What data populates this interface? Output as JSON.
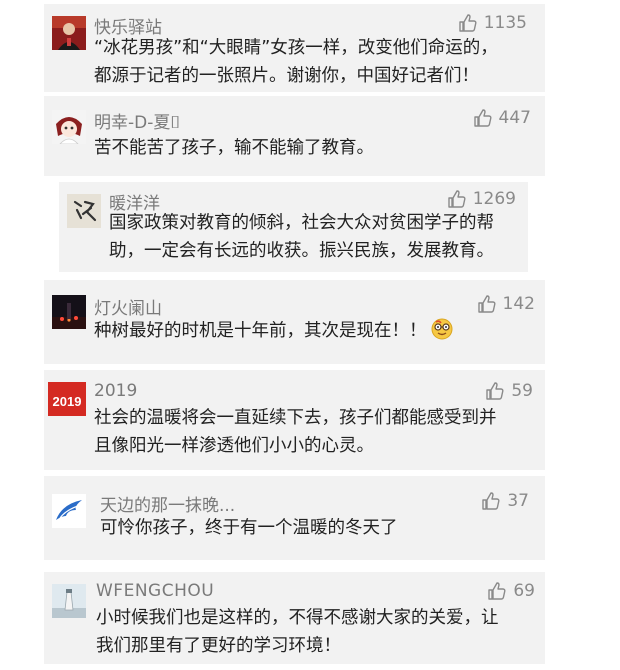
{
  "comments": [
    {
      "name": "快乐驿站",
      "likes": "1135",
      "lines": [
        "“冰花男孩”和“大眼睛”女孩一样，改变他们命运的，",
        "都源于记者的一张照片。谢谢你，中国好记者们！"
      ],
      "avatar_icon": "person-portrait-avatar"
    },
    {
      "name": "明幸-D-夏⌷",
      "likes": "447",
      "lines": [
        "苦不能苦了孩子，输不能输了教育。"
      ],
      "avatar_icon": "anime-girl-avatar"
    },
    {
      "name": "暖洋洋",
      "likes": "1269",
      "lines": [
        "国家政策对教育的倾斜，社会大众对贫困学子的帮",
        "助，一定会有长远的收获。振兴民族，发展教育。"
      ],
      "avatar_icon": "calligraphy-avatar"
    },
    {
      "name": "灯火阑山",
      "likes": "142",
      "lines": [
        "种树最好的时机是十年前，其次是现在！！"
      ],
      "emoji": "nerd-face-emoji",
      "avatar_icon": "night-scene-avatar"
    },
    {
      "name": "2019",
      "likes": "59",
      "lines": [
        "社会的温暖将会一直延续下去，孩子们都能感受到并",
        "且像阳光一样渗透他们小小的心灵。"
      ],
      "avatar_text": "2019",
      "avatar_icon": "red-2019-avatar"
    },
    {
      "name": "天边的那一抹晚...",
      "likes": "37",
      "lines": [
        "可怜你孩子，终于有一个温暖的冬天了"
      ],
      "avatar_icon": "blue-wing-avatar"
    },
    {
      "name": "WFENGCHOU",
      "likes": "69",
      "lines": [
        "小时候我们也是这样的，不得不感谢大家的关爱，让",
        "我们那里有了更好的学习环境！"
      ],
      "avatar_icon": "lighthouse-avatar"
    }
  ],
  "colors": {
    "card_bg": "#f2f2f2",
    "name": "#7a7a7a",
    "text": "#222222",
    "like": "#8a8a8a"
  }
}
